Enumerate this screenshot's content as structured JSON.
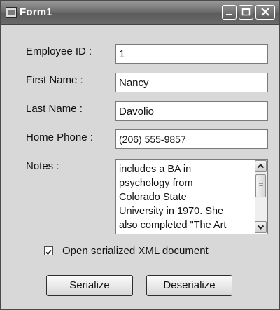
{
  "window": {
    "title": "Form1"
  },
  "fields": [
    {
      "label": "Employee ID :",
      "value": "1"
    },
    {
      "label": "First Name :",
      "value": "Nancy"
    },
    {
      "label": "Last Name :",
      "value": "Davolio"
    },
    {
      "label": "Home Phone :",
      "value": "(206) 555-9857"
    }
  ],
  "notes": {
    "label": "Notes :",
    "value": "includes a BA in\npsychology from\nColorado State\nUniversity in 1970. She\nalso completed \"The Art"
  },
  "options": {
    "open_xml_label": "Open serialized XML document",
    "open_xml_checked": true
  },
  "buttons": {
    "serialize": "Serialize",
    "deserialize": "Deserialize"
  }
}
